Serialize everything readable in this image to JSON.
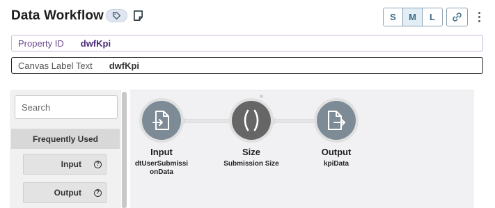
{
  "header": {
    "title": "Data Workflow",
    "size_options": [
      "S",
      "M",
      "L"
    ],
    "selected_size": "M"
  },
  "properties": {
    "property_id": {
      "label": "Property ID",
      "value": "dwfKpi"
    },
    "canvas_label": {
      "label": "Canvas Label Text",
      "value": "dwfKpi"
    }
  },
  "palette": {
    "search_placeholder": "Search",
    "section_title": "Frequently Used",
    "items": [
      {
        "label": "Input",
        "help": "?"
      },
      {
        "label": "Output",
        "help": "?"
      }
    ]
  },
  "canvas": {
    "nodes": [
      {
        "label": "Input",
        "sublabel": "dtUserSubmissionData",
        "icon": "file-import-icon"
      },
      {
        "label": "Size",
        "sublabel": "Submission Size",
        "icon": "parentheses-icon"
      },
      {
        "label": "Output",
        "sublabel": "kpiData",
        "icon": "file-export-icon"
      }
    ]
  },
  "colors": {
    "accent": "#3e6b86",
    "property_id_border": "#c9b8dd",
    "property_id_text": "#4b2a76",
    "node_file": "#7d8b96",
    "node_function": "#666666"
  }
}
